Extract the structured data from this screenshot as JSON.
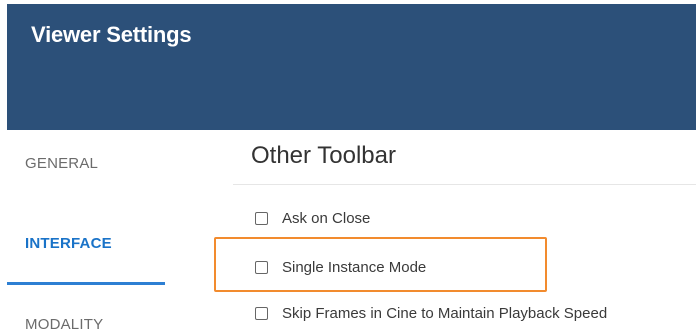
{
  "header": {
    "title": "Viewer Settings"
  },
  "sidebar": {
    "items": [
      {
        "label": "GENERAL",
        "active": false
      },
      {
        "label": "INTERFACE",
        "active": true
      },
      {
        "label": "MODALITY",
        "active": false
      }
    ]
  },
  "main": {
    "section_title": "Other Toolbar",
    "options": [
      {
        "label": "Ask on Close",
        "checked": false
      },
      {
        "label": "Single Instance Mode",
        "checked": false
      },
      {
        "label": "Skip Frames in Cine to Maintain Playback Speed",
        "checked": false
      }
    ]
  },
  "colors": {
    "header_bg": "#2c5079",
    "active_tab": "#1a73c8",
    "highlight_border": "#f28b2e"
  }
}
